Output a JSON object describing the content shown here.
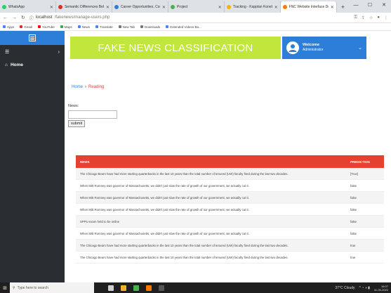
{
  "browser": {
    "tabs": [
      {
        "label": "WhatsApp",
        "color": "#25d366",
        "active": false
      },
      {
        "label": "Semantic Differences Betw",
        "color": "#d93025",
        "active": false
      },
      {
        "label": "Career Opportunities, Com",
        "color": "#2c7ed8",
        "active": false
      },
      {
        "label": "Project",
        "color": "#4caf50",
        "active": false
      },
      {
        "label": "Tracking - Kapplan Koneta",
        "color": "#f4b400",
        "active": false
      },
      {
        "label": "FNC Website Interface Dem",
        "color": "#f57c00",
        "active": true
      }
    ],
    "new_tab": "+",
    "url_host": "localhost",
    "url_path": "/fakenews/manage-users.php",
    "bookmarks": [
      {
        "label": "Apps",
        "color": "#4285f4"
      },
      {
        "label": "Gmail",
        "color": "#d93025"
      },
      {
        "label": "YouTube",
        "color": "#ff0000"
      },
      {
        "label": "Maps",
        "color": "#34a853"
      },
      {
        "label": "News",
        "color": "#4285f4"
      },
      {
        "label": "Translate",
        "color": "#4285f4"
      },
      {
        "label": "New Tab",
        "color": "#777777"
      },
      {
        "label": "Downloads",
        "color": "#777777"
      },
      {
        "label": "Extended Videos Ba...",
        "color": "#4285f4"
      }
    ]
  },
  "sidebar": {
    "home_label": "Home"
  },
  "header": {
    "banner": "FAKE NEWS CLASSIFICATION",
    "welcome_title": "Welcome",
    "welcome_user": "Administrator"
  },
  "breadcrumb": {
    "home": "Home",
    "separator": "›",
    "current": "Reading"
  },
  "form": {
    "label": "News:",
    "input_value": "",
    "submit": "submit"
  },
  "table": {
    "headers": {
      "news": "NEWS",
      "prediction": "PREDICTION"
    },
    "rows": [
      {
        "news": "The Chicago Bears have had more starting quarterbacks in the last 10 years than the total number of tenured (UW) faculty fired during the last two decades.",
        "prediction": "[True]"
      },
      {
        "news": "When Mitt Romney was governor of Massachusetts, we didn't just slow the rate of growth of our government, we actually cut it.",
        "prediction": "false"
      },
      {
        "news": "When Mitt Romney was governor of Massachusetts, we didn't just slow the rate of growth of our government, we actually cut it.",
        "prediction": "false"
      },
      {
        "news": "When Mitt Romney was governor of Massachusetts, we didn't just slow the rate of growth of our government, we actually cut it.",
        "prediction": "false"
      },
      {
        "news": "SPPU exam held to be online",
        "prediction": "false"
      },
      {
        "news": "When Mitt Romney was governor of Massachusetts, we didn't just slow the rate of growth of our government, we actually cut it.",
        "prediction": "false"
      },
      {
        "news": "The Chicago Bears have had more starting quarterbacks in the last 10 years than the total number of tenured (UW) faculty fired during the last two decades.",
        "prediction": "true"
      },
      {
        "news": "The Chicago Bears have had more starting quarterbacks in the last 10 years than the total number of tenured (UW) faculty fired during the last two decades.",
        "prediction": "true"
      }
    ]
  },
  "taskbar": {
    "search_placeholder": "Type here to search",
    "weather": "37°C Cloudy",
    "time": "16:07",
    "date": "11-05-2022"
  }
}
